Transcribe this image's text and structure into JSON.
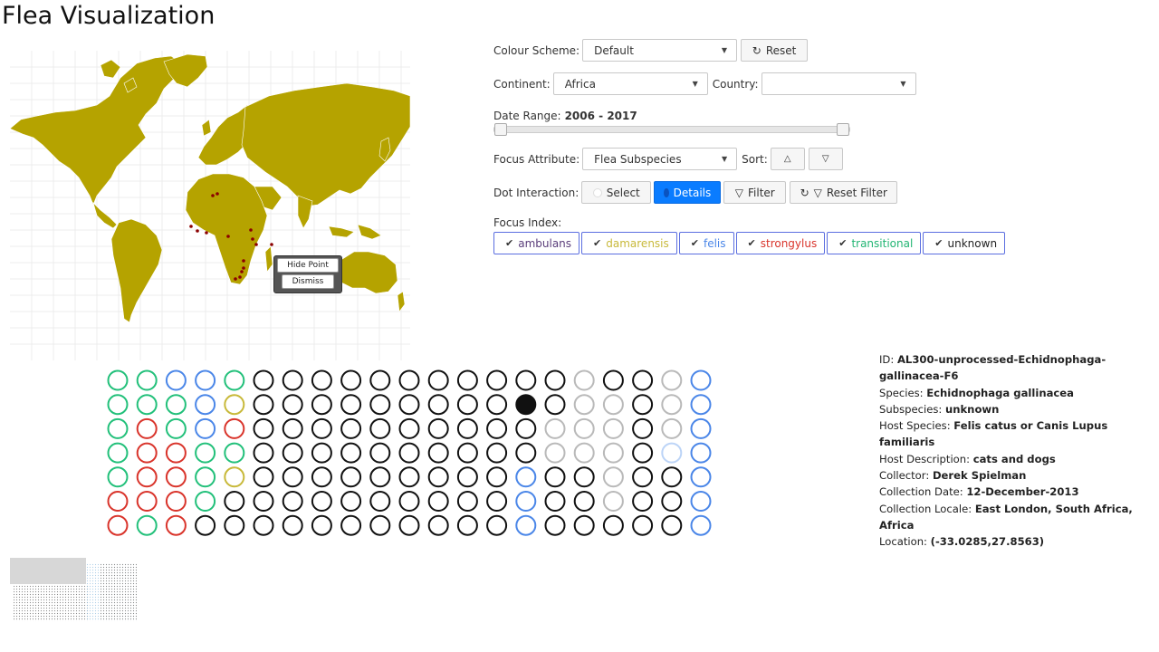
{
  "page": {
    "title": "Flea Visualization"
  },
  "map": {
    "land_color": "#b5a300",
    "sample_point_color": "#8b0000",
    "popup": {
      "hide_label": "Hide Point",
      "dismiss_label": "Dismiss"
    }
  },
  "controls": {
    "colour_scheme": {
      "label": "Colour Scheme:",
      "value": "Default",
      "reset_label": "Reset"
    },
    "continent": {
      "label": "Continent:",
      "value": "Africa"
    },
    "country": {
      "label": "Country:",
      "value": ""
    },
    "date_range": {
      "label": "Date Range:",
      "value": "2006 - 2017",
      "min": 2006,
      "max": 2017
    },
    "focus_attribute": {
      "label": "Focus Attribute:",
      "value": "Flea Subspecies"
    },
    "sort": {
      "label": "Sort:"
    },
    "dot_interaction": {
      "label": "Dot Interaction:",
      "select_label": "Select",
      "details_label": "Details",
      "filter_label": "Filter",
      "reset_filter_label": "Reset Filter",
      "active": "Details"
    },
    "focus_index": {
      "label": "Focus Index:",
      "items": [
        {
          "name": "ambulans",
          "color": "#5a3d7a",
          "checked": true
        },
        {
          "name": "damarensis",
          "color": "#c8b93a",
          "checked": true
        },
        {
          "name": "felis",
          "color": "#4a86e8",
          "checked": true
        },
        {
          "name": "strongylus",
          "color": "#d9342b",
          "checked": true
        },
        {
          "name": "transitional",
          "color": "#22b573",
          "checked": true
        },
        {
          "name": "unknown",
          "color": "#222222",
          "checked": true
        }
      ]
    }
  },
  "dot_grid": {
    "color_key": {
      "G": "#22c07a",
      "B": "#4a86e8",
      "Y": "#c8b93a",
      "R": "#d9342b",
      "K": "#111111",
      "L": "#b9b9b9",
      "P": "#bcd4f7",
      "F": "#111111"
    },
    "columns": [
      "GGGGGRR",
      "GGRRRRG",
      "BGGRRRR",
      "BBBGGGK",
      "GYRGYKK",
      "KKKKKKK",
      "KKKKKKK",
      "KKKKKKK",
      "KKKKKKK",
      "KKKKKKK",
      "KKKKKKK",
      "KKKKKKK",
      "KKKKKKK",
      "KKKKKKK",
      "KFKKBBB",
      "KKLLKKK",
      "LLLLKKK",
      "KLLLLLK",
      "KKKKKKK",
      "LLLPKKK",
      "BBBBBBB"
    ],
    "selected": {
      "column": 14,
      "row": 1
    }
  },
  "details": {
    "rows": [
      {
        "key": "ID:",
        "value": "AL300-unprocessed-Echidnophaga-gallinacea-F6"
      },
      {
        "key": "Species:",
        "value": "Echidnophaga gallinacea"
      },
      {
        "key": "Subspecies:",
        "value": "unknown"
      },
      {
        "key": "Host Species:",
        "value": "Felis catus or Canis Lupus familiaris"
      },
      {
        "key": "Host Description:",
        "value": "cats and dogs"
      },
      {
        "key": "Collector:",
        "value": "Derek Spielman"
      },
      {
        "key": "Collection Date:",
        "value": "12-December-2013"
      },
      {
        "key": "Collection Locale:",
        "value": "East London, South Africa, Africa"
      },
      {
        "key": "Location:",
        "value": "(-33.0285,27.8563)"
      }
    ]
  }
}
